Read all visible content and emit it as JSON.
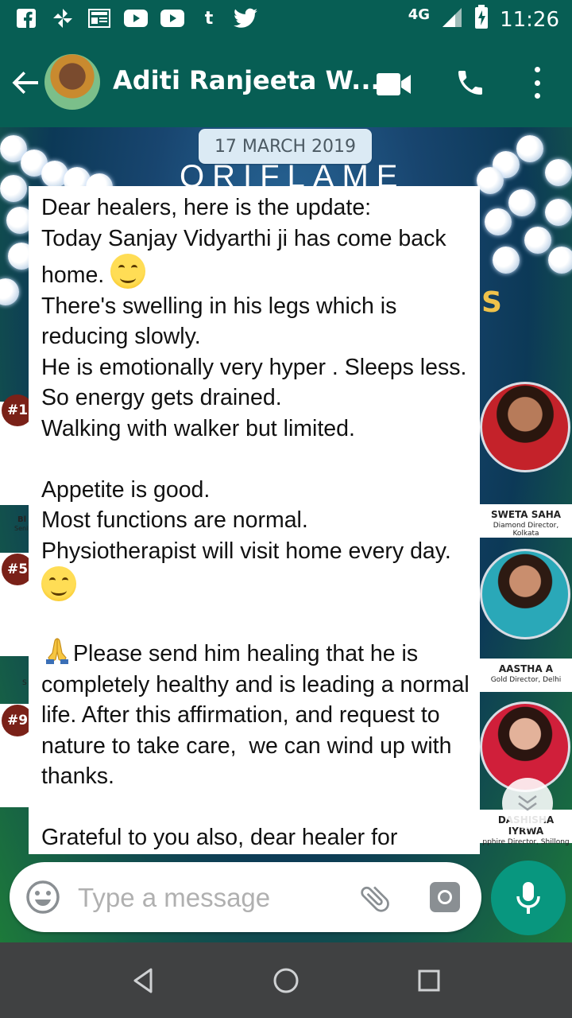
{
  "status_bar": {
    "network": "4G",
    "time": "11:26",
    "notification_icons": [
      "facebook-icon",
      "pinwheel-icon",
      "news-icon",
      "youtube-icon",
      "youtube-icon",
      "tumblr-icon",
      "twitter-icon"
    ]
  },
  "header": {
    "contact_name": "Aditi Ranjeeta W...",
    "icons": [
      "back-arrow-icon",
      "video-call-icon",
      "phone-icon",
      "more-options-icon"
    ]
  },
  "chat": {
    "date_label": "17 MARCH 2019",
    "message_text": "Dear healers, here is the update:\nToday Sanjay Vidyarthi ji has come back home.",
    "message_text_2": "There's swelling in his legs which is reducing slowly.\nHe is emotionally very hyper . Sleeps less. So energy gets drained.\nWalking with walker but limited.\n\nAppetite is good.\nMost functions are normal.\nPhysiotherapist will visit home every day.",
    "message_text_3": "Please send him healing that he is completely healthy and is leading a normal life. After this affirmation, and request to nature to take care,  we can wind up with thanks.\n\nGrateful to you also, dear healer for"
  },
  "background_image": {
    "banner_fragment": "ORIFLAME",
    "banner_letter": "S",
    "badges": [
      "#1",
      "#5",
      "#9"
    ],
    "left_fragments": [
      "Bl",
      "Seni",
      "S"
    ],
    "people": [
      {
        "name": "SWETA SAHA",
        "role": "Diamond Director, Kolkata"
      },
      {
        "name": "AASTHA A",
        "role": "Gold Director, Delhi"
      },
      {
        "name": "DASHISHA IYRWA",
        "role": "pphire Director, Shillong"
      }
    ]
  },
  "composer": {
    "placeholder": "Type a message"
  },
  "colors": {
    "header": "#075e54",
    "accent": "#08977f",
    "bubble": "#ffffff",
    "date_chip": "#dbeaf4"
  }
}
